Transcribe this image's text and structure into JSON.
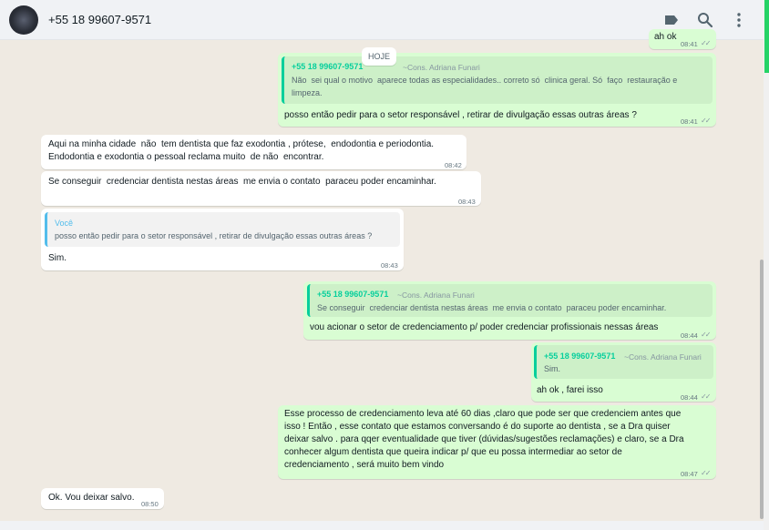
{
  "header": {
    "contact_name": "+55 18 99607-9571",
    "icons": [
      "label-icon",
      "search-icon",
      "menu-icon"
    ]
  },
  "date_chip": "HOJE",
  "messages": [
    {
      "id": "m0",
      "direction": "out",
      "time": "08:41",
      "partial_text": "ah ok"
    },
    {
      "id": "m1",
      "direction": "out",
      "quote_author": "+55 18 99607-9571",
      "quote_sub": "~Cons. Adriana Funari",
      "quote_lines": [
        "Não  sei qual o motivo  aparece todas as especialidades.. correto só  clinica geral. Só  faço  restauração e",
        "limpeza."
      ],
      "text": "posso então pedir para o setor responsável , retirar de divulgação essas outras áreas ?",
      "time": "08:41"
    },
    {
      "id": "m2",
      "direction": "in",
      "lines": [
        "Aqui na minha cidade  não  tem dentista que faz exodontia , prótese,  endodontia e periodontia.",
        "Endodontia e exodontia o pessoal reclama muito  de não  encontrar."
      ],
      "time": "08:42"
    },
    {
      "id": "m3",
      "direction": "in",
      "text": "Se conseguir  credenciar dentista nestas áreas  me envia o contato  paraceu poder encaminhar.",
      "time": "08:43"
    },
    {
      "id": "m4",
      "direction": "in",
      "quote_author": "Você",
      "quote_text": "posso então pedir para o setor responsável , retirar de divulgação essas outras áreas ?",
      "text": "Sim.",
      "time": "08:43"
    },
    {
      "id": "m5",
      "direction": "out",
      "quote_author": "+55 18 99607-9571",
      "quote_sub": "~Cons. Adriana Funari",
      "quote_text": "Se conseguir  credenciar dentista nestas áreas  me envia o contato  paraceu poder encaminhar.",
      "text": "vou acionar o setor de credenciamento p/ poder credenciar profissionais nessas áreas",
      "time": "08:44"
    },
    {
      "id": "m6",
      "direction": "out",
      "quote_author": "+55 18 99607-9571",
      "quote_sub": "~Cons. Adriana Funari",
      "quote_text": "Sim.",
      "text": "ah ok , farei isso",
      "time": "08:44"
    },
    {
      "id": "m7",
      "direction": "out",
      "lines": [
        "Esse processo de credenciamento leva até 60 dias ,claro que pode ser que credenciem antes que",
        "isso ! Então , esse contato que estamos conversando é do suporte ao dentista , se a Dra quiser",
        "deixar salvo . para qqer eventualidade que tiver (dúvidas/sugestões reclamações) e claro, se a Dra",
        "conhecer algum dentista que queira indicar p/ que eu possa intermediar ao setor de",
        "credenciamento , será muito bem vindo"
      ],
      "time": "08:47"
    },
    {
      "id": "m8",
      "direction": "in",
      "text": "Ok. Vou deixar salvo.",
      "time": "08:50"
    }
  ]
}
